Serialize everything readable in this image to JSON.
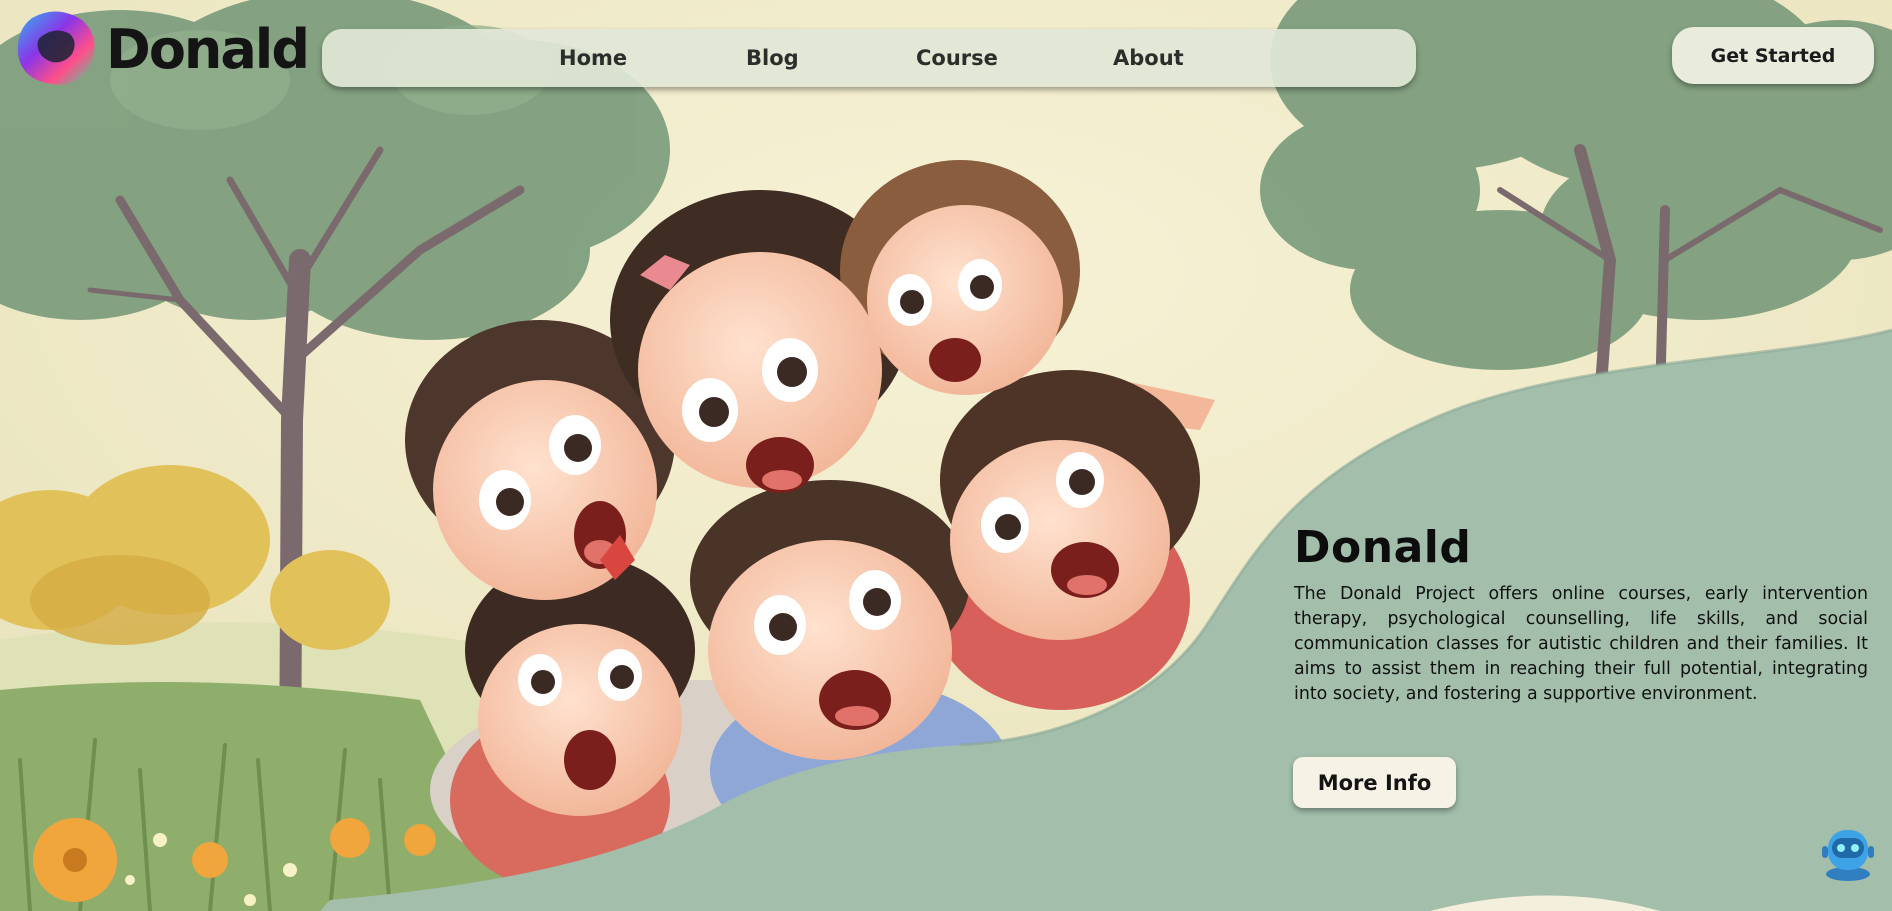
{
  "brand": {
    "name": "Donald"
  },
  "nav": {
    "items": [
      {
        "label": "Home"
      },
      {
        "label": "Blog"
      },
      {
        "label": "Course"
      },
      {
        "label": "About"
      }
    ],
    "cta_label": "Get Started"
  },
  "hero": {
    "title": "Donald",
    "description": "The Donald Project offers online courses, early intervention therapy, psychological counselling, life skills, and social communication classes for autistic children and their families. It aims to assist them in reaching their full potential, integrating into society, and fostering a supportive environment.",
    "button_label": "More Info",
    "image": "cartoon-children-illustration"
  },
  "assistant": {
    "icon": "chatbot-robot-icon"
  },
  "colors": {
    "panel_green": "#a3bfac",
    "background_cream": "#f1ecd0",
    "foliage": "#7f9f7e",
    "nav_bg": "#e1e7d6",
    "button_bg": "#f6f2e6"
  }
}
